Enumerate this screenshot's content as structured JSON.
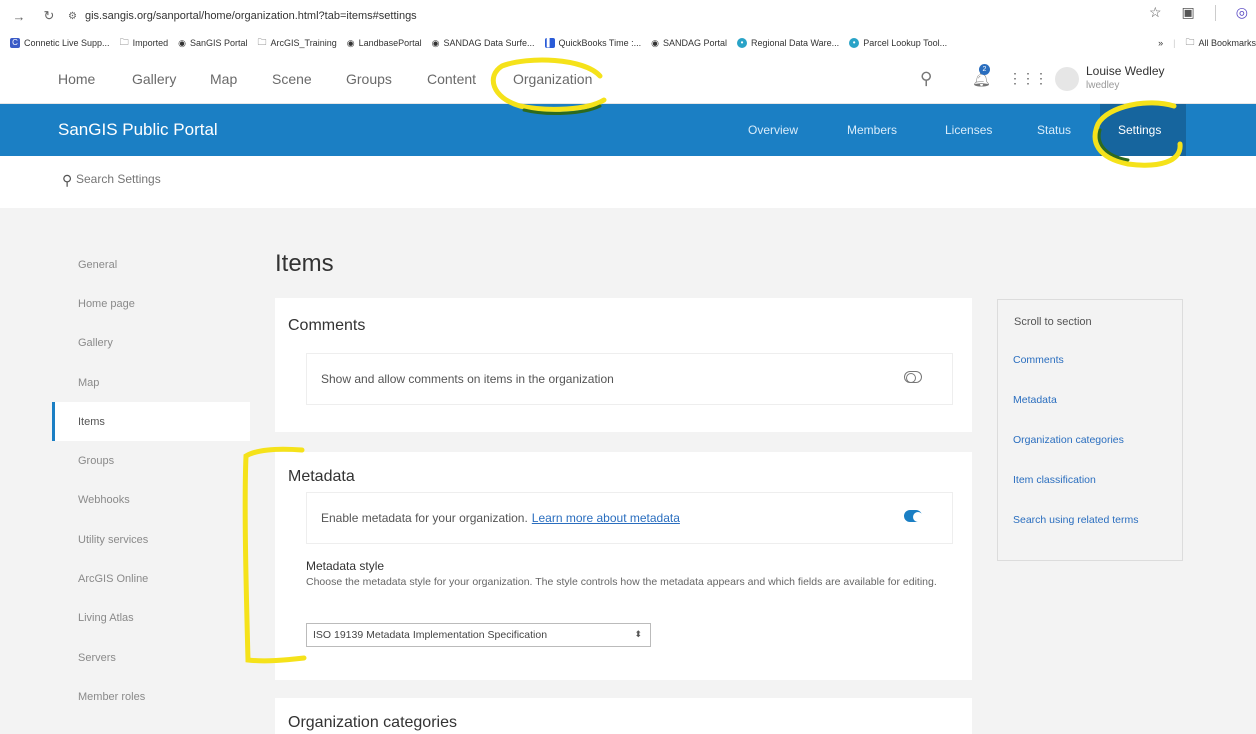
{
  "browser": {
    "url": "gis.sangis.org/sanportal/home/organization.html?tab=items#settings",
    "bookmarks": [
      {
        "label": "Connetic Live Supp...",
        "icon_color": "#3a5bc7"
      },
      {
        "label": "Imported",
        "icon": "folder-icon"
      },
      {
        "label": "SanGIS Portal",
        "icon": "globe-icon"
      },
      {
        "label": "ArcGIS_Training",
        "icon": "folder-icon"
      },
      {
        "label": "LandbasePortal",
        "icon": "globe-icon"
      },
      {
        "label": "SANDAG Data Surfe...",
        "icon": "globe-icon"
      },
      {
        "label": "QuickBooks Time :...",
        "icon_color": "#2a5bd7"
      },
      {
        "label": "SANDAG Portal",
        "icon": "globe-icon"
      },
      {
        "label": "Regional Data Ware...",
        "icon_color": "#29a3c7"
      },
      {
        "label": "Parcel Lookup Tool...",
        "icon_color": "#29a3c7"
      }
    ],
    "bookmarks_overflow": "»",
    "all_bookmarks": "All Bookmarks"
  },
  "topnav": {
    "home": "Home",
    "gallery": "Gallery",
    "map": "Map",
    "scene": "Scene",
    "groups": "Groups",
    "content": "Content",
    "organization": "Organization",
    "notification_count": "2",
    "user_name": "Louise Wedley",
    "user_id": "lwedley"
  },
  "banner": {
    "title": "SanGIS Public Portal",
    "tabs": [
      "Overview",
      "Members",
      "Licenses",
      "Status",
      "Settings"
    ],
    "active_tab": "Settings"
  },
  "search": {
    "placeholder": "Search Settings"
  },
  "sidebar": {
    "items": [
      "General",
      "Home page",
      "Gallery",
      "Map",
      "Items",
      "Groups",
      "Webhooks",
      "Utility services",
      "ArcGIS Online",
      "Living Atlas",
      "Servers",
      "Member roles"
    ],
    "active": "Items"
  },
  "main": {
    "title": "Items",
    "comments": {
      "heading": "Comments",
      "toggle_label": "Show and allow comments on items in the organization",
      "enabled": false
    },
    "metadata": {
      "heading": "Metadata",
      "toggle_label": "Enable metadata for your organization.",
      "learn_more": "Learn more about metadata",
      "enabled": true,
      "style_label": "Metadata style",
      "style_desc": "Choose the metadata style for your organization. The style controls how the metadata appears and which fields are available for editing.",
      "style_value": "ISO 19139 Metadata Implementation Specification"
    },
    "org_categories": {
      "heading": "Organization categories"
    }
  },
  "scroll_panel": {
    "header": "Scroll to section",
    "links": [
      "Comments",
      "Metadata",
      "Organization categories",
      "Item classification",
      "Search using related terms"
    ]
  },
  "colors": {
    "accent": "#1b7fc4",
    "annotation": "#f5e21a",
    "link": "#2a6ebf"
  }
}
